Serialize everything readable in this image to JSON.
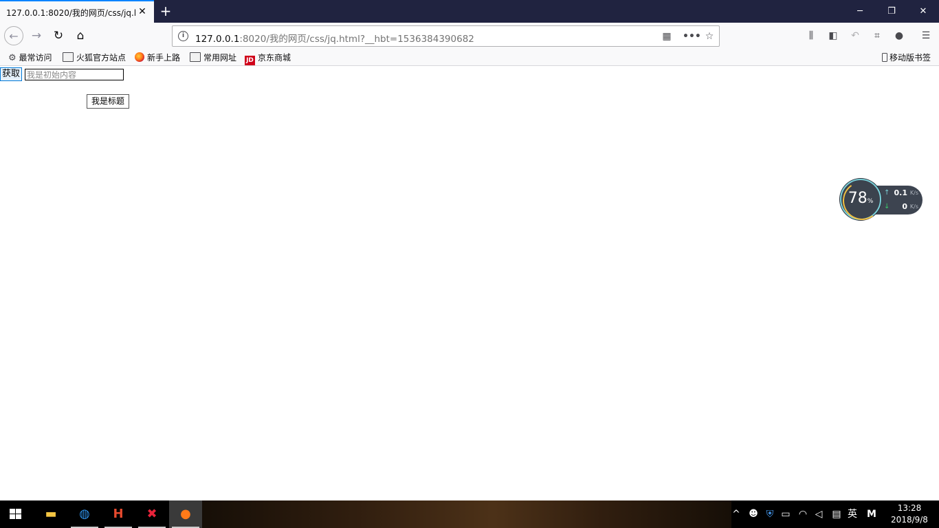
{
  "browser": {
    "tab_title": "127.0.0.1:8020/我的网页/css/jq.ht",
    "new_tab_label": "+",
    "url_host": "127.0.0.1",
    "url_rest": ":8020/我的网页/css/jq.html?__hbt=1536384390682"
  },
  "bookmarks": {
    "items": [
      {
        "label": "最常访问",
        "icon": "gear-icon"
      },
      {
        "label": "火狐官方站点",
        "icon": "folder-icon"
      },
      {
        "label": "新手上路",
        "icon": "firefox-icon"
      },
      {
        "label": "常用网址",
        "icon": "folder-icon"
      },
      {
        "label": "京东商城",
        "icon": "jd-icon"
      }
    ],
    "jd_badge": "JD",
    "mobile_label": "移动版书签"
  },
  "page": {
    "get_button": "获取",
    "input_placeholder": "我是初始内容",
    "title_box": "我是标题"
  },
  "net_widget": {
    "percent": "78",
    "percent_unit": "%",
    "upload": "0.1",
    "download": "0",
    "unit": "K/s"
  },
  "taskbar": {
    "ime_label": "英",
    "clock_time": "13:28",
    "clock_date": "2018/9/8"
  },
  "colors": {
    "tab_accent": "#0a84ff",
    "tabbar_bg": "#202340",
    "toolbar_bg": "#f9f9fa"
  }
}
